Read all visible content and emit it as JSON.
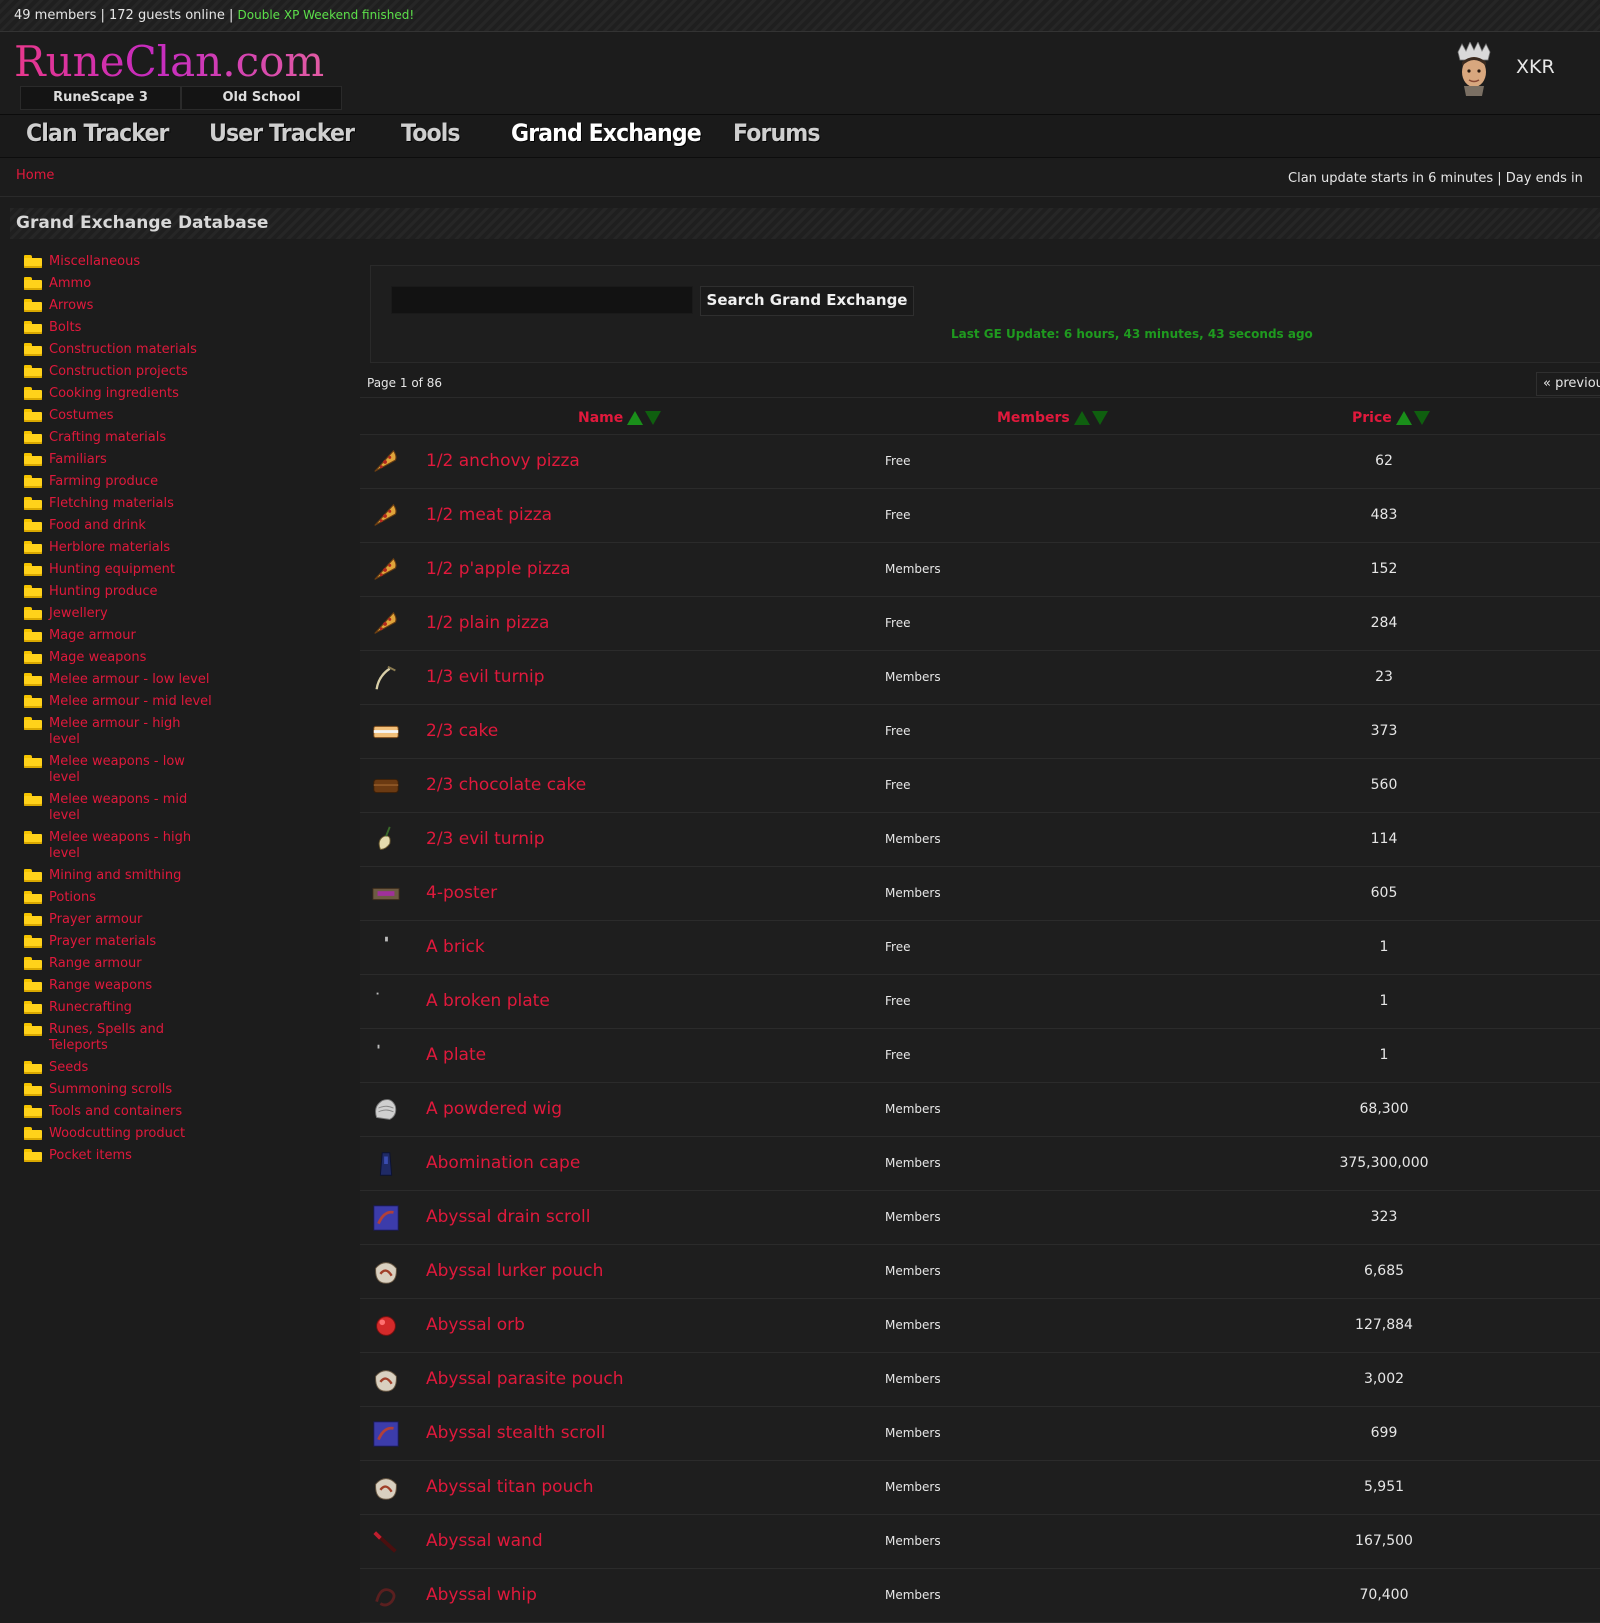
{
  "topbar": {
    "stats": "49 members | 172 guests online | ",
    "announcement": "Double XP Weekend finished!"
  },
  "header": {
    "logo": "RuneClan.com",
    "game_tabs": [
      "RuneScape 3",
      "Old School"
    ],
    "username": "XKR"
  },
  "nav": {
    "items": [
      "Clan Tracker",
      "User Tracker",
      "Tools",
      "Grand Exchange",
      "Forums"
    ],
    "active": "Grand Exchange"
  },
  "breadcrumb": {
    "home": "Home"
  },
  "clan_status": "Clan update starts in 6 minutes | Day ends in",
  "section_title": "Grand Exchange Database",
  "categories": [
    "Miscellaneous",
    "Ammo",
    "Arrows",
    "Bolts",
    "Construction materials",
    "Construction projects",
    "Cooking ingredients",
    "Costumes",
    "Crafting materials",
    "Familiars",
    "Farming produce",
    "Fletching materials",
    "Food and drink",
    "Herblore materials",
    "Hunting equipment",
    "Hunting produce",
    "Jewellery",
    "Mage armour",
    "Mage weapons",
    "Melee armour - low level",
    "Melee armour - mid level",
    "Melee armour - high level",
    "Melee weapons - low level",
    "Melee weapons - mid level",
    "Melee weapons - high level",
    "Mining and smithing",
    "Potions",
    "Prayer armour",
    "Prayer materials",
    "Range armour",
    "Range weapons",
    "Runecrafting",
    "Runes, Spells and Teleports",
    "Seeds",
    "Summoning scrolls",
    "Tools and containers",
    "Woodcutting product",
    "Pocket items"
  ],
  "search": {
    "value": "",
    "button": "Search Grand Exchange",
    "last_update": "Last GE Update: 6 hours, 43 minutes, 43 seconds ago"
  },
  "pagination": {
    "info": "Page 1 of 86",
    "prev": "« previous"
  },
  "table": {
    "headers": [
      "Name",
      "Members",
      "Price"
    ],
    "rows": [
      {
        "icon": "pizza-slice-icon",
        "name": "1/2 anchovy pizza",
        "members": "Free",
        "price": "62"
      },
      {
        "icon": "pizza-slice-icon",
        "name": "1/2 meat pizza",
        "members": "Free",
        "price": "483"
      },
      {
        "icon": "pizza-slice-icon",
        "name": "1/2 p'apple pizza",
        "members": "Members",
        "price": "152"
      },
      {
        "icon": "pizza-slice-icon",
        "name": "1/2 plain pizza",
        "members": "Free",
        "price": "284"
      },
      {
        "icon": "turnip-stick-icon",
        "name": "1/3 evil turnip",
        "members": "Members",
        "price": "23"
      },
      {
        "icon": "cake-icon",
        "name": "2/3 cake",
        "members": "Free",
        "price": "373"
      },
      {
        "icon": "chocolate-cake-icon",
        "name": "2/3 chocolate cake",
        "members": "Free",
        "price": "560"
      },
      {
        "icon": "turnip-icon",
        "name": "2/3 evil turnip",
        "members": "Members",
        "price": "114"
      },
      {
        "icon": "bed-icon",
        "name": "4-poster",
        "members": "Members",
        "price": "605"
      },
      {
        "icon": "brick-icon",
        "name": "A brick",
        "members": "Free",
        "price": "1"
      },
      {
        "icon": "broken-plate-icon",
        "name": "A broken plate",
        "members": "Free",
        "price": "1"
      },
      {
        "icon": "plate-icon",
        "name": "A plate",
        "members": "Free",
        "price": "1"
      },
      {
        "icon": "wig-icon",
        "name": "A powdered wig",
        "members": "Members",
        "price": "68,300"
      },
      {
        "icon": "cape-icon",
        "name": "Abomination cape",
        "members": "Members",
        "price": "375,300,000"
      },
      {
        "icon": "scroll-icon",
        "name": "Abyssal drain scroll",
        "members": "Members",
        "price": "323"
      },
      {
        "icon": "pouch-icon",
        "name": "Abyssal lurker pouch",
        "members": "Members",
        "price": "6,685"
      },
      {
        "icon": "orb-icon",
        "name": "Abyssal orb",
        "members": "Members",
        "price": "127,884"
      },
      {
        "icon": "pouch-icon",
        "name": "Abyssal parasite pouch",
        "members": "Members",
        "price": "3,002"
      },
      {
        "icon": "scroll-icon",
        "name": "Abyssal stealth scroll",
        "members": "Members",
        "price": "699"
      },
      {
        "icon": "pouch-icon",
        "name": "Abyssal titan pouch",
        "members": "Members",
        "price": "5,951"
      },
      {
        "icon": "wand-icon",
        "name": "Abyssal wand",
        "members": "Members",
        "price": "167,500"
      },
      {
        "icon": "whip-icon",
        "name": "Abyssal whip",
        "members": "Members",
        "price": "70,400"
      }
    ]
  },
  "colors": {
    "background": "#1c1c1c",
    "link": "#e0193c",
    "success": "#1f9a1f",
    "announcement": "#5ce04a",
    "folder": "#ffd21a"
  }
}
